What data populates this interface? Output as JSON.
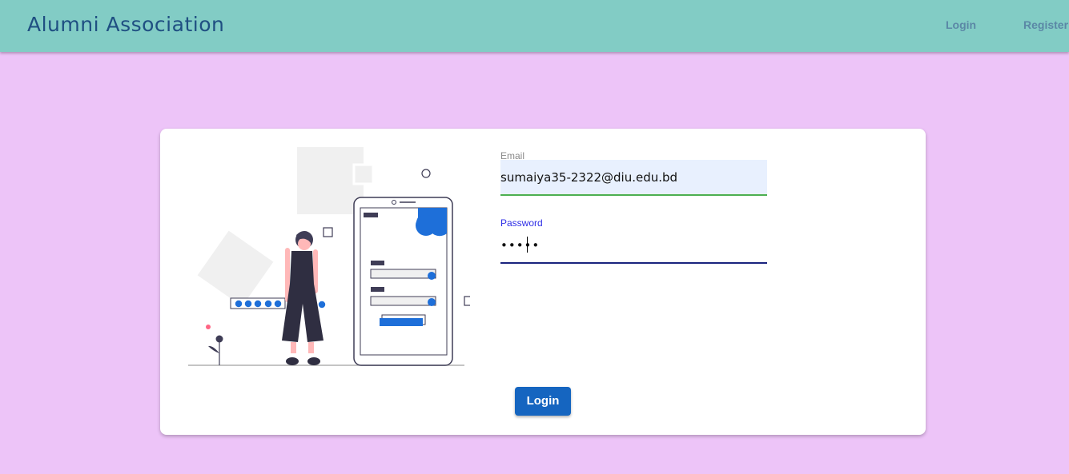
{
  "header": {
    "brand": "Alumni Association",
    "nav": {
      "login_label": "Login",
      "register_label": "Register"
    }
  },
  "login_form": {
    "email": {
      "label": "Email",
      "value": "sumaiya35-2322@diu.edu.bd"
    },
    "password": {
      "label": "Password",
      "value": "•••••"
    },
    "submit_label": "Login"
  },
  "colors": {
    "header_bg": "#82ccc5",
    "page_bg": "#edc4f8",
    "brand_text": "#1f4f82",
    "accent_blue": "#1565c0",
    "illustration_blue": "#1e6fd9"
  }
}
